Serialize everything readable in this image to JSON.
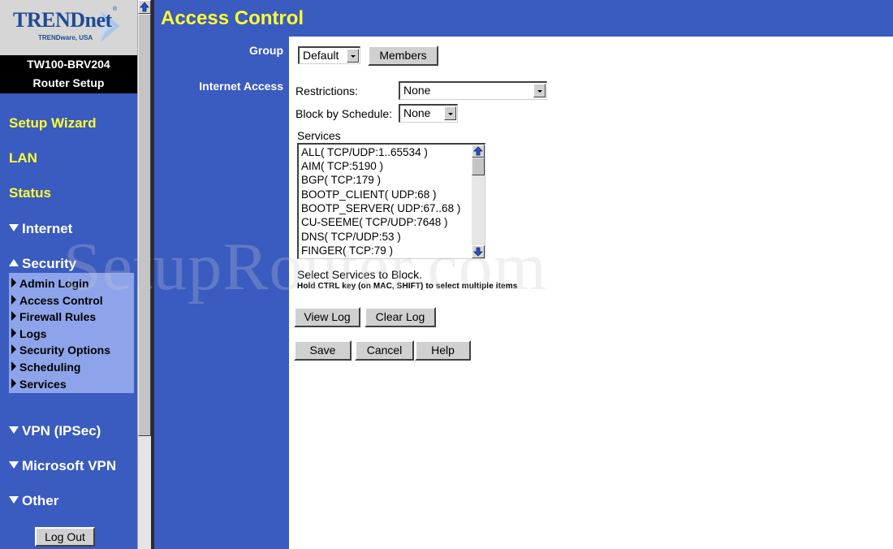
{
  "brand": {
    "logo": "TRENDnet",
    "logo_registered": "®",
    "logo_sub": "TRENDware, USA",
    "model": "TW100-BRV204",
    "subtitle": "Router Setup"
  },
  "sidebar": {
    "links": [
      {
        "label": "Setup Wizard"
      },
      {
        "label": "LAN"
      },
      {
        "label": "Status"
      }
    ],
    "sections": [
      {
        "label": "Internet",
        "expanded": false
      },
      {
        "label": "Security",
        "expanded": true
      },
      {
        "label": "VPN (IPSec)",
        "expanded": false
      },
      {
        "label": "Microsoft VPN",
        "expanded": false
      },
      {
        "label": "Other",
        "expanded": false
      }
    ],
    "security_items": [
      {
        "label": "Admin Login"
      },
      {
        "label": "Access Control"
      },
      {
        "label": "Firewall Rules"
      },
      {
        "label": "Logs"
      },
      {
        "label": "Security Options"
      },
      {
        "label": "Scheduling"
      },
      {
        "label": "Services"
      }
    ],
    "logout_label": "Log Out"
  },
  "page": {
    "title": "Access Control",
    "group_label": "Group",
    "internet_access_label": "Internet Access",
    "group_select": {
      "value": "Default"
    },
    "members_button": "Members",
    "restrictions_label": "Restrictions:",
    "restrictions_select": {
      "value": "None"
    },
    "block_schedule_label": "Block by Schedule:",
    "block_schedule_select": {
      "value": "None"
    },
    "services_label": "Services",
    "services": [
      "ALL( TCP/UDP:1..65534 )",
      "AIM( TCP:5190 )",
      "BGP( TCP:179 )",
      "BOOTP_CLIENT( UDP:68 )",
      "BOOTP_SERVER( UDP:67..68 )",
      "CU-SEEME( TCP/UDP:7648 )",
      "DNS( TCP/UDP:53 )",
      "FINGER( TCP:79 )"
    ],
    "select_hint": "Select Services to Block.",
    "multi_hint": "Hold CTRL key (on MAC, SHIFT) to select multiple items",
    "view_log_button": "View Log",
    "clear_log_button": "Clear Log",
    "save_button": "Save",
    "cancel_button": "Cancel",
    "help_button": "Help"
  },
  "watermark": "SetupRouter.com",
  "colors": {
    "frame_blue": "#3a5bbf",
    "title_yellow": "#ffff33",
    "submenu_bg": "#8da4ea",
    "logo_blue": "#1f4a94"
  }
}
